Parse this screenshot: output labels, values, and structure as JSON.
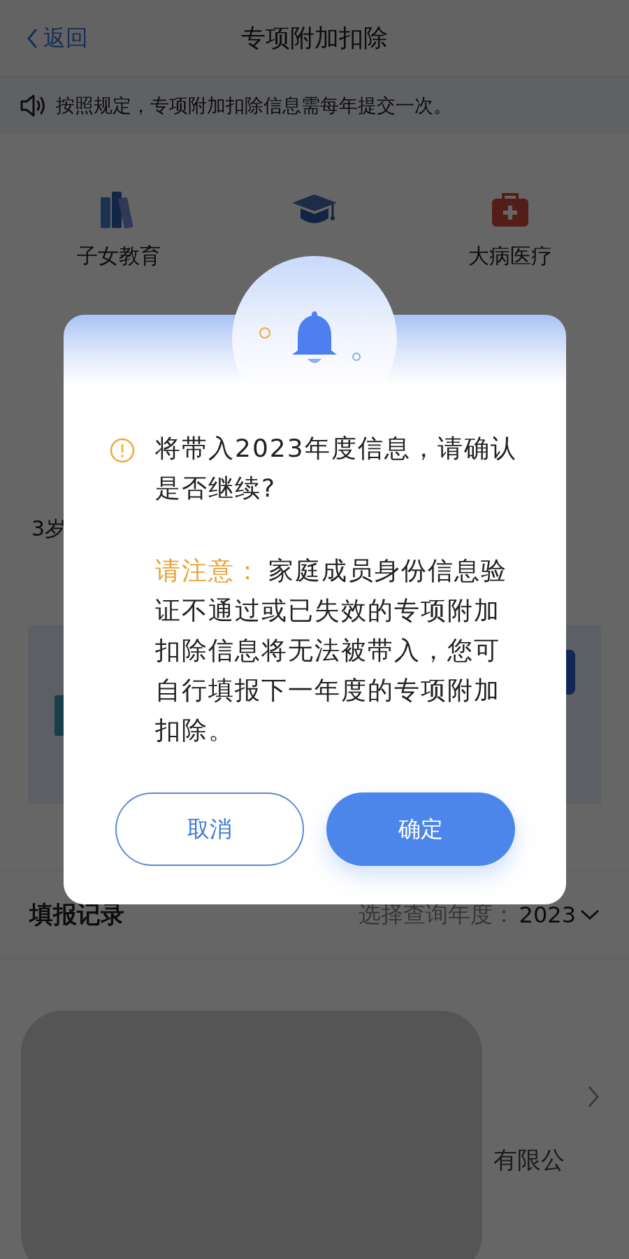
{
  "header": {
    "back": "返回",
    "title": "专项附加扣除"
  },
  "notice": "按照规定，专项附加扣除信息需每年提交一次。",
  "categories": [
    {
      "label": "子女教育",
      "kind": "books"
    },
    {
      "kind": "cap"
    },
    {
      "label": "大病医疗",
      "kind": "medkit"
    }
  ],
  "hidden_rows": [
    "3岁"
  ],
  "records": {
    "title": "填报记录",
    "year_label": "选择查询年度：",
    "year": "2023",
    "entry_text": "有限公"
  },
  "dialog": {
    "message": "将带入2023年度信息，请确认是否继续?",
    "note_label": "请注意：",
    "note_text": "家庭成员身份信息验证不通过或已失效的专项附加扣除信息将无法被带入，您可自行填报下一年度的专项附加扣除。",
    "buttons": [
      {
        "label": "取消",
        "kind": "secondary"
      },
      {
        "label": "确定",
        "kind": "primary"
      }
    ]
  }
}
